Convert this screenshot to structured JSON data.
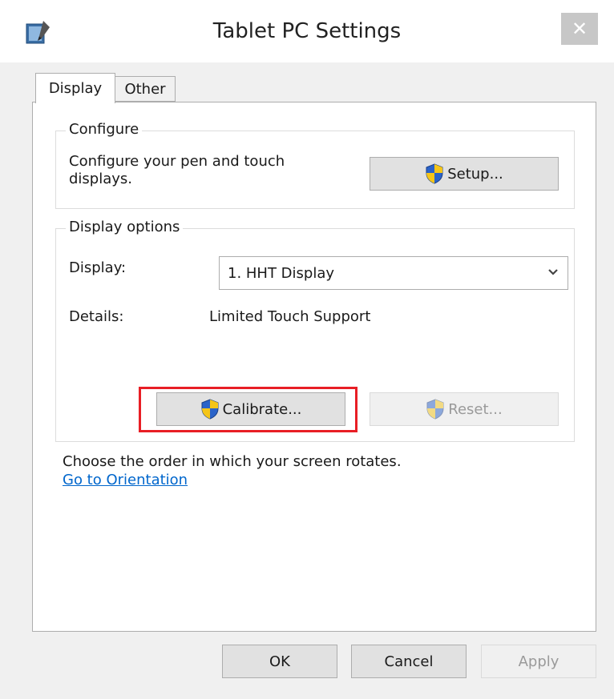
{
  "window": {
    "title": "Tablet PC Settings",
    "close_label": "✕"
  },
  "tabs": [
    {
      "label": "Display",
      "selected": true
    },
    {
      "label": "Other",
      "selected": false
    }
  ],
  "configure": {
    "group_label": "Configure",
    "description": "Configure your pen and touch\ndisplays.",
    "setup_button": "Setup..."
  },
  "display_options": {
    "group_label": "Display options",
    "display_label": "Display:",
    "display_value": "1. HHT Display",
    "details_label": "Details:",
    "details_value": "Limited Touch Support",
    "calibrate_button": "Calibrate...",
    "reset_button": "Reset..."
  },
  "orientation": {
    "text": "Choose the order in which your screen rotates.",
    "link": "Go to Orientation"
  },
  "footer": {
    "ok": "OK",
    "cancel": "Cancel",
    "apply": "Apply"
  },
  "colors": {
    "highlight": "#e81e25",
    "link": "#0066cc"
  }
}
